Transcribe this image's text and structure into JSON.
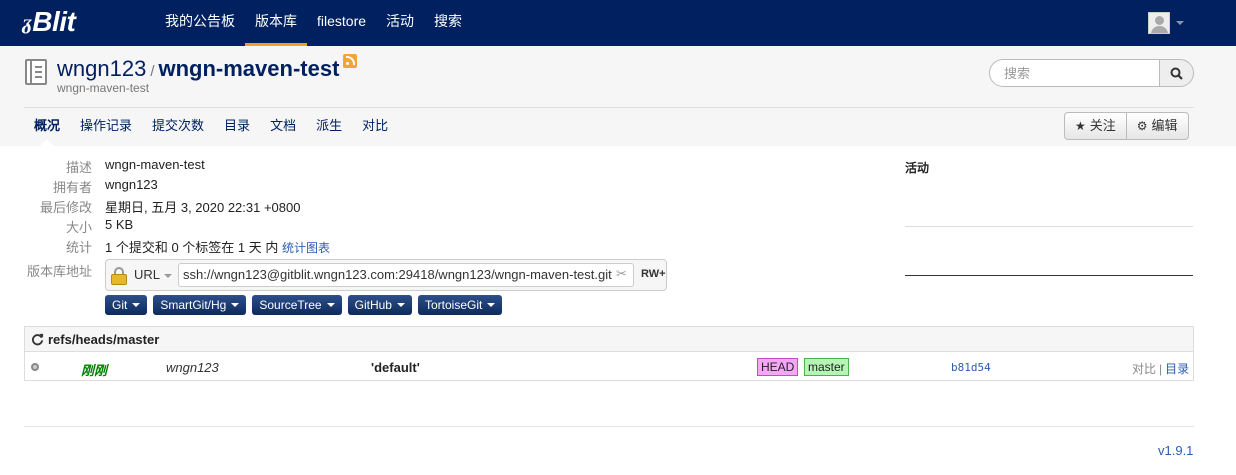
{
  "app": {
    "logo_mark": "ᵹ",
    "logo_text": "Blit"
  },
  "nav": [
    {
      "label": "我的公告板"
    },
    {
      "label": "版本库"
    },
    {
      "label": "filestore"
    },
    {
      "label": "活动"
    },
    {
      "label": "搜索"
    }
  ],
  "nav_active": "版本库",
  "repo": {
    "owner": "wngn123",
    "separator": "/",
    "name": "wngn-maven-test",
    "subtitle": "wngn-maven-test"
  },
  "search": {
    "placeholder": "搜索"
  },
  "subnav": [
    {
      "label": "概况"
    },
    {
      "label": "操作记录"
    },
    {
      "label": "提交次数"
    },
    {
      "label": "目录"
    },
    {
      "label": "文档"
    },
    {
      "label": "派生"
    },
    {
      "label": "对比"
    }
  ],
  "actions": {
    "watch": "关注",
    "edit": "编辑"
  },
  "summary": {
    "description_label": "描述",
    "description": "wngn-maven-test",
    "owner_label": "拥有者",
    "owner": "wngn123",
    "modified_label": "最后修改",
    "modified": "星期日, 五月 3, 2020 22:31 +0800",
    "size_label": "大小",
    "size": "5 KB",
    "stats_label": "统计",
    "stats": "1 个提交和 0 个标签在 1 天 内",
    "stats_link": "统计图表",
    "url_label": "版本库地址"
  },
  "clone": {
    "protocol": "URL",
    "url": "ssh://wngn123@gitblit.wngn123.com:29418/wngn123/wngn-maven-test.git",
    "permission": "RW+"
  },
  "clients": [
    {
      "label": "Git"
    },
    {
      "label": "SmartGit/Hg"
    },
    {
      "label": "SourceTree"
    },
    {
      "label": "GitHub"
    },
    {
      "label": "TortoiseGit"
    }
  ],
  "activity": {
    "title": "活动"
  },
  "log": {
    "ref": "refs/heads/master",
    "commit": {
      "date": "刚刚",
      "author": "wngn123",
      "message": "'default'",
      "tag_head": "HEAD",
      "tag_master": "master",
      "hash": "b81d54",
      "compare": "对比",
      "link_sep": "|",
      "tree": "目录"
    }
  },
  "footer": {
    "version": "v1.9.1"
  },
  "colors": {
    "navbar": "#002060",
    "nav_active_underline": "#f0a020",
    "link": "#2a5db0",
    "head_tag": "#f7a6f7",
    "master_tag": "#b6f4b6",
    "commit_date": "#008000"
  }
}
